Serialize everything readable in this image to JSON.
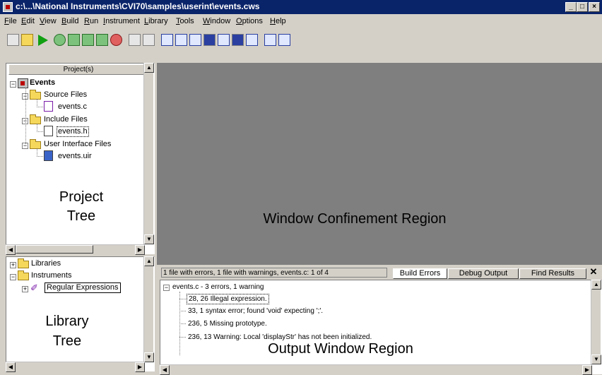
{
  "window": {
    "title": "c:\\...\\National Instruments\\CVI70\\samples\\userint\\events.cws"
  },
  "menu": [
    {
      "pre": "",
      "u": "F",
      "post": "ile"
    },
    {
      "pre": "",
      "u": "E",
      "post": "dit"
    },
    {
      "pre": "",
      "u": "V",
      "post": "iew"
    },
    {
      "pre": "",
      "u": "B",
      "post": "uild"
    },
    {
      "pre": "",
      "u": "R",
      "post": "un"
    },
    {
      "pre": "",
      "u": "I",
      "post": "nstrument"
    },
    {
      "pre": "",
      "u": "L",
      "post": "ibrary"
    },
    {
      "pre": "",
      "u": "T",
      "post": "ools"
    },
    {
      "pre": "",
      "u": "W",
      "post": "indow"
    },
    {
      "pre": "",
      "u": "O",
      "post": "ptions"
    },
    {
      "pre": "",
      "u": "H",
      "post": "elp"
    }
  ],
  "project": {
    "header": "Project(s)",
    "root": "Events",
    "folders": [
      "Source Files",
      "Include Files",
      "User Interface Files"
    ],
    "files": [
      "events.c",
      "events.h",
      "events.uir"
    ],
    "region_label_1": "Project",
    "region_label_2": "Tree"
  },
  "library": {
    "items": [
      "Libraries",
      "Instruments"
    ],
    "sub": "Regular Expressions",
    "region_label_1": "Library",
    "region_label_2": "Tree"
  },
  "confinement": {
    "label": "Window Confinement Region"
  },
  "output": {
    "status": "1 file with errors,  1 file with warnings,    events.c:  1 of 4",
    "tabs": [
      "Build Errors",
      "Debug Output",
      "Find Results"
    ],
    "close": "✕",
    "root": "events.c - 3 errors, 1 warning",
    "lines": [
      "28, 26   Illegal expression.",
      "33, 1   syntax error; found 'void' expecting ';'.",
      "236, 5   Missing prototype.",
      "236, 13   Warning: Local 'displayStr' has not been initialized."
    ],
    "region_label": "Output Window Region"
  },
  "colors": {
    "titlebar": "#0a246a",
    "confinement": "#7f7f7f",
    "face": "#d4d0c8"
  }
}
